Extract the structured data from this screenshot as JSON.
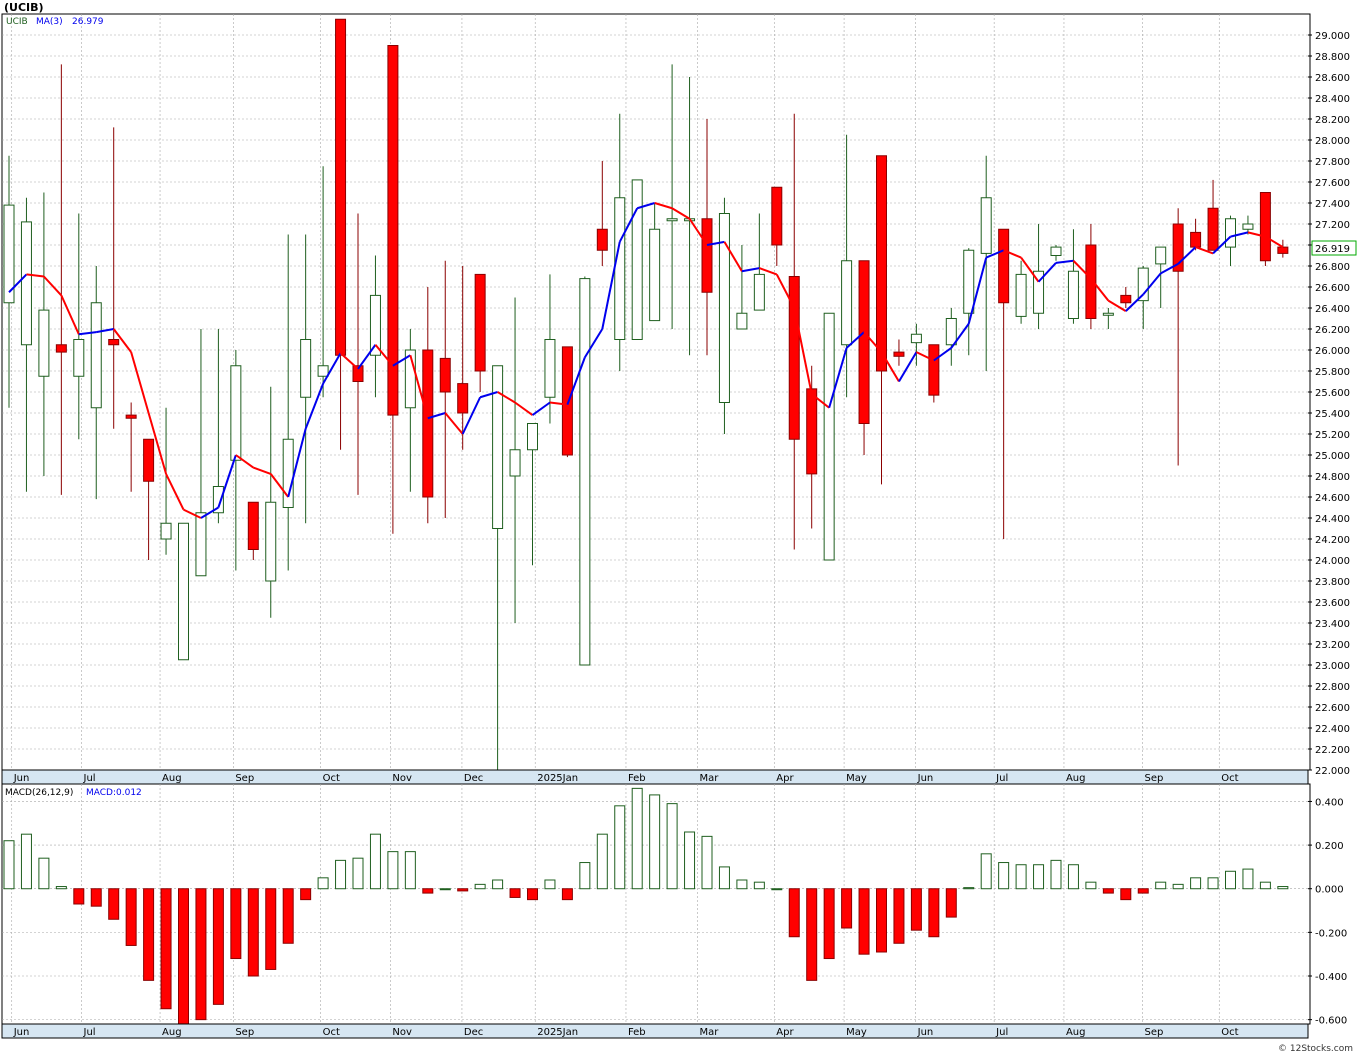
{
  "header": {
    "symbol": "(UCIB)",
    "ma_symbol": "UCIB",
    "ma_label": "MA(3)",
    "ma_value": "26.979",
    "macd_label": "MACD(26,12,9)",
    "macd_value_label": "MACD:0.012",
    "last_price": "26.919",
    "footer": "© 12Stocks.com"
  },
  "colors": {
    "up": "#ffffff",
    "up_border": "#1f5f1f",
    "down": "#ff0000",
    "down_border": "#8b0000",
    "ma_up": "#0000ee",
    "ma_down": "#ff0000",
    "macd_pos": "#ffffff",
    "macd_pos_border": "#1f5f1f",
    "macd_neg": "#ff0000",
    "grid": "#a8a8a8",
    "axis_band": "#d6e6f2",
    "badge_bg": "#ffffff",
    "badge_border": "#00aa00"
  },
  "chart_data": [
    {
      "type": "candlestick",
      "title": "(UCIB)",
      "x_months": [
        "Jun",
        "Jul",
        "Aug",
        "Sep",
        "Oct",
        "Nov",
        "Dec",
        "2025Jan",
        "Feb",
        "Mar",
        "Apr",
        "May",
        "Jun",
        "Jul",
        "Aug",
        "Sep",
        "Oct"
      ],
      "ylim": [
        22.0,
        29.2
      ],
      "y_ticks": [
        "22.000",
        "22.200",
        "22.400",
        "22.600",
        "22.800",
        "23.000",
        "23.200",
        "23.400",
        "23.600",
        "23.800",
        "24.000",
        "24.200",
        "24.400",
        "24.600",
        "24.800",
        "25.000",
        "25.200",
        "25.400",
        "25.600",
        "25.800",
        "26.000",
        "26.200",
        "26.400",
        "26.600",
        "26.800",
        "27.000",
        "27.200",
        "27.400",
        "27.600",
        "27.800",
        "28.000",
        "28.200",
        "28.400",
        "28.600",
        "28.800",
        "29.000"
      ],
      "ohlc": [
        [
          26.45,
          27.85,
          25.45,
          27.38
        ],
        [
          26.05,
          27.45,
          24.65,
          27.22
        ],
        [
          25.75,
          27.5,
          24.8,
          26.38
        ],
        [
          26.05,
          28.72,
          24.62,
          25.98
        ],
        [
          25.75,
          27.3,
          25.15,
          26.1
        ],
        [
          25.45,
          26.8,
          24.58,
          26.45
        ],
        [
          26.1,
          28.12,
          25.25,
          26.05
        ],
        [
          25.38,
          25.5,
          24.65,
          25.35
        ],
        [
          25.15,
          25.15,
          24.0,
          24.75
        ],
        [
          24.2,
          25.45,
          24.05,
          24.35
        ],
        [
          23.05,
          24.35,
          23.05,
          24.35
        ],
        [
          23.85,
          26.2,
          23.85,
          24.45
        ],
        [
          24.45,
          26.2,
          24.35,
          24.7
        ],
        [
          24.95,
          26.0,
          23.9,
          25.85
        ],
        [
          24.55,
          24.55,
          24.0,
          24.1
        ],
        [
          23.8,
          25.65,
          23.45,
          24.55
        ],
        [
          24.5,
          27.1,
          23.9,
          25.15
        ],
        [
          25.55,
          27.1,
          24.35,
          26.1
        ],
        [
          25.75,
          27.75,
          25.55,
          25.85
        ],
        [
          29.15,
          29.15,
          25.05,
          25.95
        ],
        [
          25.85,
          27.3,
          24.62,
          25.7
        ],
        [
          25.95,
          26.9,
          25.55,
          26.52
        ],
        [
          28.9,
          28.9,
          24.25,
          25.38
        ],
        [
          25.45,
          26.2,
          24.65,
          26.0
        ],
        [
          26.0,
          26.6,
          24.35,
          24.6
        ],
        [
          25.92,
          26.85,
          24.4,
          25.6
        ],
        [
          25.68,
          26.8,
          25.05,
          25.4
        ],
        [
          26.72,
          26.72,
          25.6,
          25.8
        ],
        [
          24.3,
          25.8,
          22.0,
          25.85
        ],
        [
          24.8,
          26.5,
          23.4,
          25.05
        ],
        [
          25.05,
          25.3,
          23.95,
          25.3
        ],
        [
          25.55,
          26.72,
          25.3,
          26.1
        ],
        [
          26.03,
          26.03,
          24.98,
          25.0
        ],
        [
          23.0,
          26.7,
          23.0,
          26.68
        ],
        [
          27.15,
          27.8,
          26.8,
          26.95
        ],
        [
          26.1,
          28.25,
          25.8,
          27.45
        ],
        [
          26.1,
          27.6,
          26.1,
          27.62
        ],
        [
          26.28,
          27.4,
          26.28,
          27.15
        ],
        [
          27.25,
          28.72,
          26.2,
          27.25
        ],
        [
          27.25,
          28.6,
          25.95,
          27.25
        ],
        [
          27.25,
          28.2,
          25.95,
          26.55
        ],
        [
          25.5,
          27.45,
          25.2,
          27.3
        ],
        [
          26.2,
          27.0,
          26.2,
          26.35
        ],
        [
          26.38,
          27.3,
          26.38,
          26.72
        ],
        [
          27.55,
          27.55,
          26.8,
          27.0
        ],
        [
          26.7,
          28.25,
          24.1,
          25.15
        ],
        [
          25.63,
          25.85,
          24.3,
          24.82
        ],
        [
          24.0,
          26.35,
          24.0,
          26.35
        ],
        [
          26.05,
          28.05,
          25.55,
          26.85
        ],
        [
          26.85,
          26.85,
          25.0,
          25.3
        ],
        [
          27.85,
          27.85,
          24.72,
          25.8
        ],
        [
          25.98,
          26.1,
          25.85,
          25.94
        ],
        [
          26.07,
          26.25,
          25.85,
          26.15
        ],
        [
          26.05,
          26.05,
          25.5,
          25.57
        ],
        [
          26.05,
          26.4,
          25.85,
          26.3
        ],
        [
          26.35,
          26.97,
          25.95,
          26.95
        ],
        [
          26.92,
          27.85,
          25.8,
          27.45
        ],
        [
          27.15,
          27.15,
          24.2,
          26.45
        ],
        [
          26.32,
          26.85,
          26.25,
          26.72
        ],
        [
          26.35,
          27.2,
          26.2,
          26.75
        ],
        [
          26.9,
          27.0,
          26.85,
          26.98
        ],
        [
          26.3,
          27.15,
          26.25,
          26.75
        ],
        [
          27.0,
          27.2,
          26.2,
          26.3
        ],
        [
          26.35,
          26.4,
          26.2,
          26.35
        ],
        [
          26.52,
          26.6,
          26.4,
          26.45
        ],
        [
          26.47,
          26.8,
          26.2,
          26.78
        ],
        [
          26.82,
          26.98,
          26.4,
          26.98
        ],
        [
          27.2,
          27.35,
          24.9,
          26.75
        ],
        [
          27.12,
          27.25,
          26.95,
          26.98
        ],
        [
          27.35,
          27.62,
          26.95,
          26.95
        ],
        [
          26.98,
          27.28,
          26.8,
          27.25
        ],
        [
          27.15,
          27.28,
          27.1,
          27.2
        ],
        [
          27.5,
          27.5,
          26.8,
          26.85
        ],
        [
          26.98,
          27.05,
          26.88,
          26.92
        ]
      ],
      "ma3": [
        26.55,
        26.72,
        26.7,
        26.52,
        26.15,
        26.17,
        26.2,
        25.98,
        25.4,
        24.82,
        24.48,
        24.4,
        24.5,
        25.0,
        24.88,
        24.82,
        24.6,
        25.25,
        25.68,
        25.97,
        25.82,
        26.05,
        25.85,
        25.95,
        25.35,
        25.4,
        25.2,
        25.55,
        25.6,
        25.5,
        25.38,
        25.5,
        25.48,
        25.93,
        26.2,
        27.03,
        27.35,
        27.4,
        27.35,
        27.25,
        27.0,
        27.03,
        26.75,
        26.78,
        26.72,
        26.4,
        25.58,
        25.45,
        26.02,
        26.17,
        25.98,
        25.7,
        25.98,
        25.9,
        26.02,
        26.25,
        26.88,
        26.95,
        26.88,
        26.65,
        26.83,
        26.85,
        26.68,
        26.47,
        26.37,
        26.53,
        26.73,
        26.82,
        26.98,
        26.92,
        27.08,
        27.12,
        27.08,
        26.98
      ],
      "last": 26.919
    },
    {
      "type": "bar",
      "title": "MACD(26,12,9)",
      "ylim": [
        -0.62,
        0.48
      ],
      "y_ticks": [
        "0.400",
        "0.200",
        "0.000",
        "-0.200",
        "-0.400",
        "-0.600"
      ],
      "values": [
        0.22,
        0.25,
        0.14,
        0.01,
        -0.07,
        -0.08,
        -0.14,
        -0.26,
        -0.42,
        -0.55,
        -0.62,
        -0.6,
        -0.53,
        -0.32,
        -0.4,
        -0.37,
        -0.25,
        -0.05,
        0.05,
        0.13,
        0.14,
        0.25,
        0.17,
        0.17,
        -0.02,
        0.0,
        -0.01,
        0.02,
        0.04,
        -0.04,
        -0.05,
        0.04,
        -0.05,
        0.12,
        0.25,
        0.38,
        0.46,
        0.43,
        0.39,
        0.26,
        0.24,
        0.1,
        0.04,
        0.03,
        0.0,
        -0.22,
        -0.42,
        -0.32,
        -0.18,
        -0.3,
        -0.29,
        -0.25,
        -0.19,
        -0.22,
        -0.13,
        0.005,
        0.16,
        0.12,
        0.11,
        0.11,
        0.13,
        0.11,
        0.03,
        -0.02,
        -0.05,
        -0.02,
        0.03,
        0.02,
        0.05,
        0.05,
        0.08,
        0.09,
        0.03,
        0.01
      ],
      "macd_last": 0.012
    }
  ]
}
